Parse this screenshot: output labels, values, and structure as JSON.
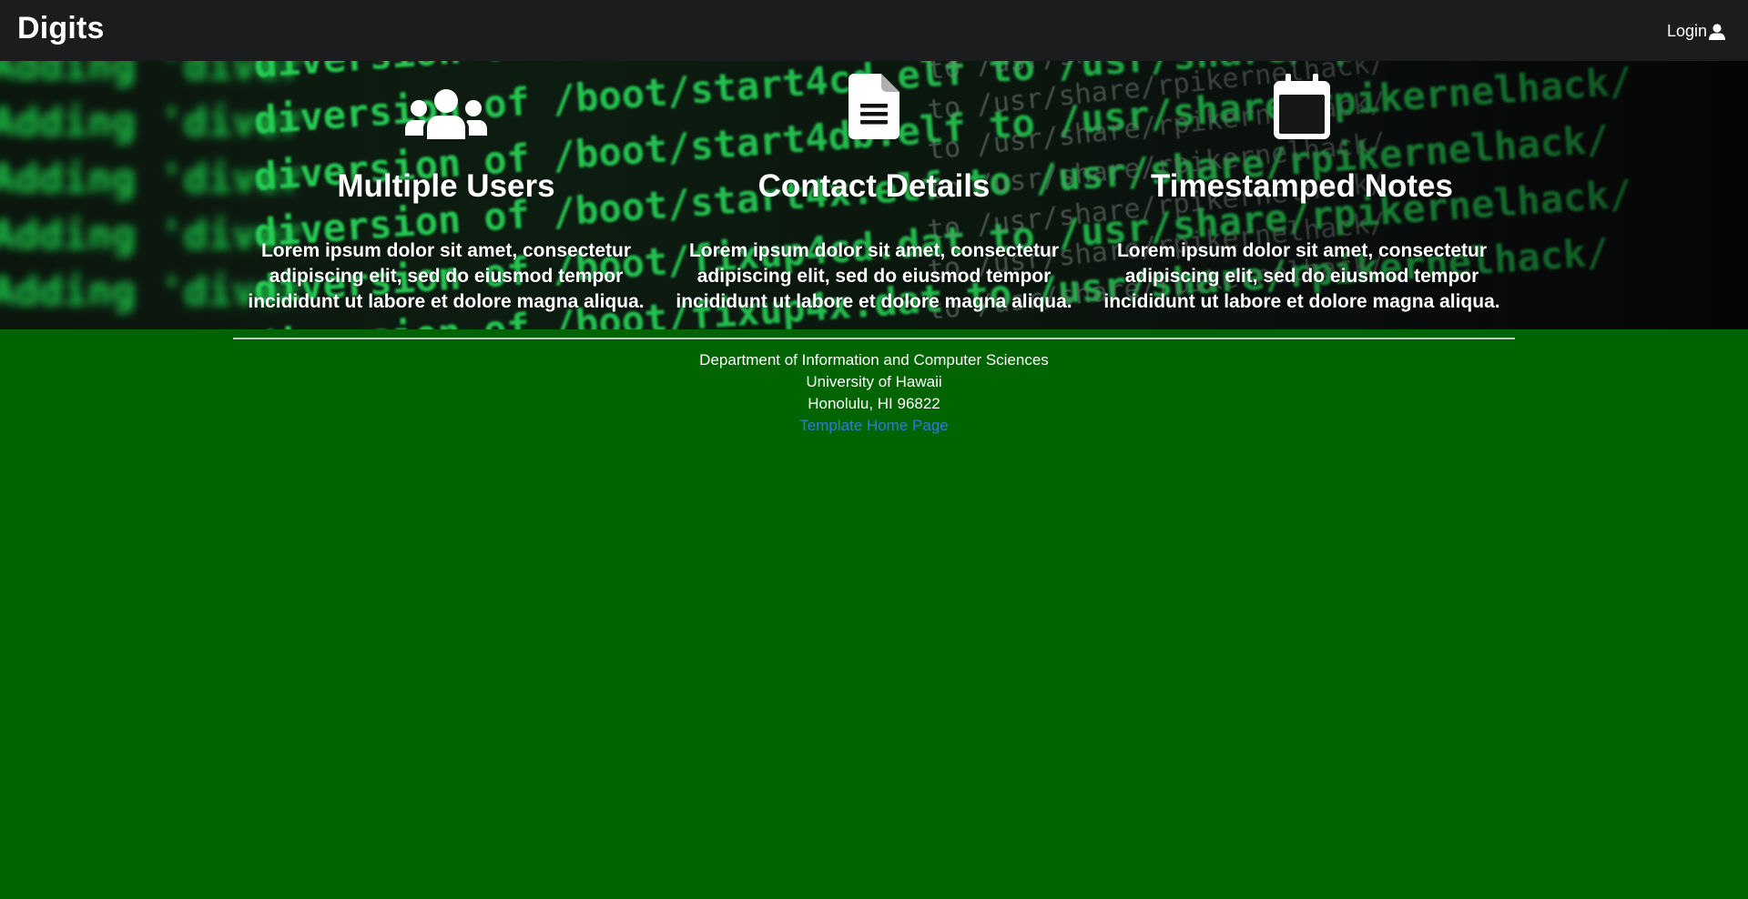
{
  "navbar": {
    "brand": "Digits",
    "login_label": "Login",
    "login_icon": "user-icon"
  },
  "hero": {
    "background": "green terminal code text image",
    "features": [
      {
        "icon": "users-icon",
        "title": "Multiple Users",
        "text": "Lorem ipsum dolor sit amet, consectetur adipiscing elit, sed do eiusmod tempor incididunt ut labore et dolore magna aliqua."
      },
      {
        "icon": "file-icon",
        "title": "Contact Details",
        "text": "Lorem ipsum dolor sit amet, consectetur adipiscing elit, sed do eiusmod tempor incididunt ut labore et dolore magna aliqua."
      },
      {
        "icon": "calendar-icon",
        "title": "Timestamped Notes",
        "text": "Lorem ipsum dolor sit amet, consectetur adipiscing elit, sed do eiusmod tempor incididunt ut labore et dolore magna aliqua."
      }
    ]
  },
  "footer": {
    "line1": "Department of Information and Computer Sciences",
    "line2": "University of Hawaii",
    "line3": "Honolulu, HI 96822",
    "link": "Template Home Page"
  },
  "colors": {
    "navbar_bg": "#1b1c1d",
    "page_bg": "#006400",
    "link": "#2f7dd1",
    "code_green": "#22c94a"
  }
}
